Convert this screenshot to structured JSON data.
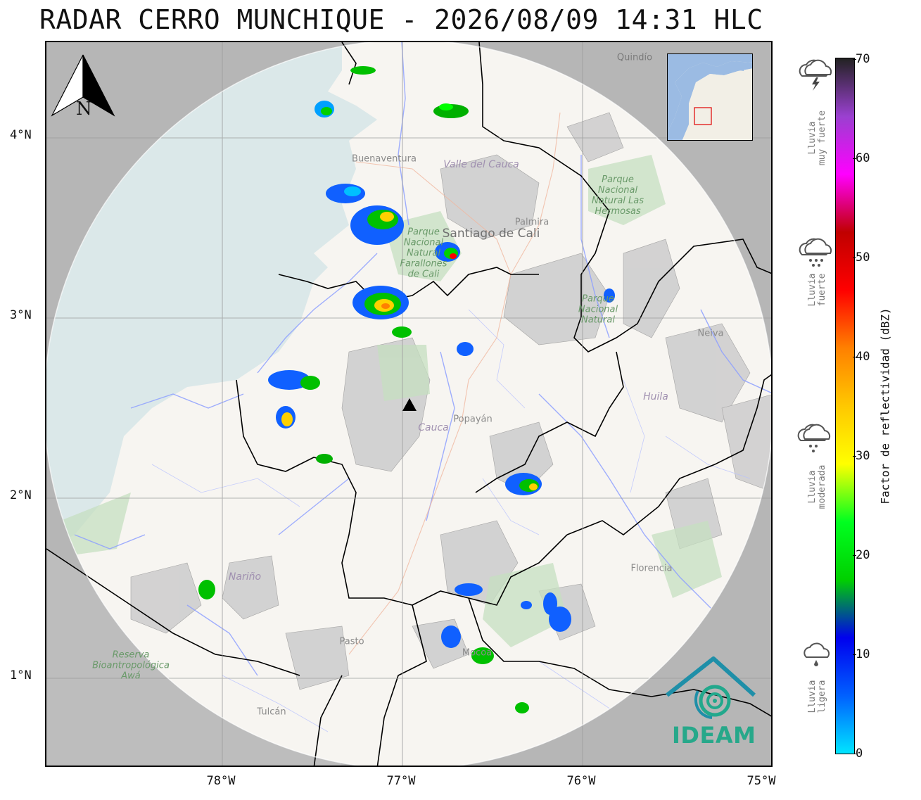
{
  "title": "RADAR CERRO MUNCHIQUE - 2026/08/09 14:31 HLC",
  "axes": {
    "lat_ticks": [
      "4°N",
      "3°N",
      "2°N",
      "1°N"
    ],
    "lon_ticks": [
      "78°W",
      "77°W",
      "76°W",
      "75°W"
    ]
  },
  "colorbar": {
    "title": "Factor de reflectividad (dBZ)",
    "ticks": [
      "70",
      "60",
      "50",
      "40",
      "30",
      "20",
      "10",
      "0"
    ],
    "min": 0,
    "max": 70,
    "stops": [
      "#00e5ff",
      "#0060ff",
      "#0000ee",
      "#00d000",
      "#00ff20",
      "#ffff00",
      "#ffc800",
      "#ff8000",
      "#ff0000",
      "#c00000",
      "#ff00ff",
      "#9a40d0",
      "#222222"
    ]
  },
  "rain_categories": [
    {
      "line1": "Lluvia",
      "line2": "muy fuerte",
      "icon": "storm-cloud-icon"
    },
    {
      "line1": "Lluvia",
      "line2": "fuerte",
      "icon": "heavy-rain-cloud-icon"
    },
    {
      "line1": "Lluvia",
      "line2": "moderada",
      "icon": "moderate-rain-cloud-icon"
    },
    {
      "line1": "Lluvia",
      "line2": "ligera",
      "icon": "light-rain-cloud-icon"
    }
  ],
  "north_arrow": {
    "label": "N"
  },
  "logo": {
    "text": "IDEAM"
  },
  "places": [
    {
      "name": "Buenaventura"
    },
    {
      "name": "Valle del Cauca"
    },
    {
      "name": "Santiago de Cali"
    },
    {
      "name": "Palmira"
    },
    {
      "name": "Parque Nacional Natural Farallones de Cali"
    },
    {
      "name": "Parque Nacional Natural Las Hermosas"
    },
    {
      "name": "Parque Nacional Natural"
    },
    {
      "name": "Neiva"
    },
    {
      "name": "Huila"
    },
    {
      "name": "Popayán"
    },
    {
      "name": "Cauca"
    },
    {
      "name": "Nariño"
    },
    {
      "name": "Florencia"
    },
    {
      "name": "Pasto"
    },
    {
      "name": "Mocoa"
    },
    {
      "name": "Tulcán"
    },
    {
      "name": "Reserva Bioantropológica Awá"
    },
    {
      "name": "Quindío"
    }
  ],
  "colors": {
    "land": "#f7f5f1",
    "sea": "#dbe8e9",
    "outside_range": "#c0c0c0",
    "rivers": "#8ea0ff",
    "borders": "#000000",
    "logo": "#27a88a"
  }
}
